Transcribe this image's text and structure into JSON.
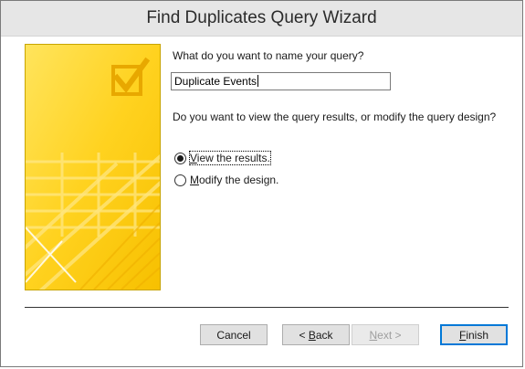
{
  "window": {
    "title": "Find Duplicates Query Wizard"
  },
  "prompts": {
    "name_question": "What do you want to name your query?",
    "view_question": "Do you want to view the query results, or modify the query design?"
  },
  "query_name": {
    "value": "Duplicate Events"
  },
  "options": [
    {
      "label": "View the results.",
      "mnemonic": "V",
      "rest": "iew the results.",
      "selected": true
    },
    {
      "label": "Modify the design.",
      "mnemonic": "M",
      "rest": "odify the design.",
      "selected": false
    }
  ],
  "buttons": {
    "cancel": {
      "label": "Cancel",
      "enabled": true
    },
    "back": {
      "pre": "< ",
      "mnemonic": "B",
      "rest": "ack",
      "label": "< Back",
      "enabled": true
    },
    "next": {
      "pre": "",
      "mnemonic": "N",
      "rest": "ext >",
      "label": "Next >",
      "enabled": false
    },
    "finish": {
      "pre": "",
      "mnemonic": "F",
      "rest": "inish",
      "label": "Finish",
      "enabled": true
    }
  },
  "colors": {
    "art_yellow": "#ffd21f",
    "art_light": "#ffe46a",
    "art_dark": "#f0b400",
    "accent": "#0078d7"
  },
  "icons": {
    "wizard_art": "checkbox-check-icon"
  }
}
